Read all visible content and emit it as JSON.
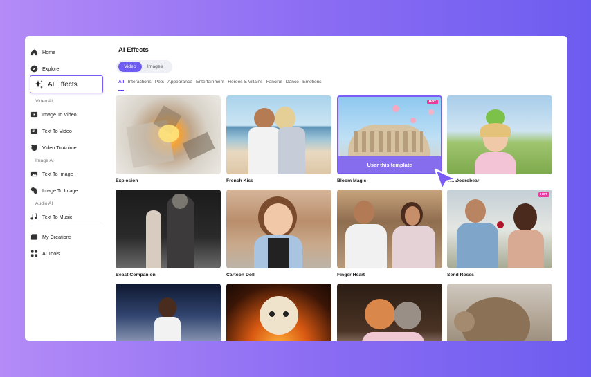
{
  "sidebar": {
    "home": "Home",
    "explore": "Explore",
    "ai_effects": "AI Effects",
    "section_video": "Video AI",
    "image_to_video": "Image To Video",
    "text_to_video": "Text To Video",
    "video_to_anime": "Video To Anime",
    "section_image": "Image AI",
    "text_to_image": "Text To Image",
    "image_to_image": "Image To Image",
    "section_audio": "Audio AI",
    "text_to_music": "Text To Music",
    "my_creations": "My Creations",
    "ai_tools": "AI Tools"
  },
  "main": {
    "title": "AI Effects",
    "toggle": [
      "Video",
      "Images"
    ],
    "tabs": [
      "All",
      "Interactions",
      "Pets",
      "Appearance",
      "Entertainment",
      "Heroes & Villains",
      "Fanciful",
      "Dance",
      "Emotions"
    ],
    "hot_badge": "HOT",
    "use_template": "User this template",
    "cards": [
      {
        "label": "Explosion",
        "icon": "explosion-thumbnail"
      },
      {
        "label": "French Kiss",
        "icon": "beach-couple-thumbnail"
      },
      {
        "label": "Bloom Magic",
        "icon": "colosseum-flowers-thumbnail"
      },
      {
        "label": "om Doorobear",
        "icon": "girl-frog-thumbnail"
      },
      {
        "label": "Beast Companion",
        "icon": "runway-wolf-thumbnail"
      },
      {
        "label": "Cartoon Doll",
        "icon": "cartoon-girl-thumbnail"
      },
      {
        "label": "Finger Heart",
        "icon": "couple-heart-thumbnail"
      },
      {
        "label": "Send Roses",
        "icon": "roses-couple-thumbnail"
      },
      {
        "label": "",
        "icon": "runway-model-thumbnail"
      },
      {
        "label": "",
        "icon": "dog-fire-thumbnail"
      },
      {
        "label": "",
        "icon": "dog-cat-hug-thumbnail"
      },
      {
        "label": "",
        "icon": "cat-thumbnail"
      }
    ]
  },
  "colors": {
    "accent": "#6f5cf1",
    "hot": "#e93c9e",
    "background_start": "#b48bf7",
    "background_end": "#6d5cf0"
  }
}
